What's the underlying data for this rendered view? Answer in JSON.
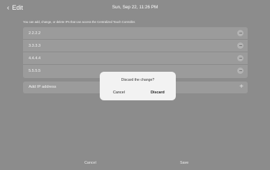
{
  "header": {
    "back_label": "Edit",
    "datetime": "Sun, Sep 22, 11:26 PM"
  },
  "description": "You can add, change, or delete IPs that can access the Centralized Touch Controller.",
  "ip_list": [
    {
      "ip": "2.2.2.2"
    },
    {
      "ip": "3.3.3.3"
    },
    {
      "ip": "4.4.4.4"
    },
    {
      "ip": "5.5.5.5"
    }
  ],
  "add_row": {
    "label": "Add IP address",
    "icon": "plus-icon"
  },
  "footer": {
    "cancel_label": "Cancel",
    "save_label": "Save"
  },
  "dialog": {
    "title": "Discard the change?",
    "cancel_label": "Cancel",
    "discard_label": "Discard"
  },
  "colors": {
    "background": "#8c8c8c",
    "row_background": "#9b9b9b",
    "dialog_background": "#f2f2f2"
  }
}
